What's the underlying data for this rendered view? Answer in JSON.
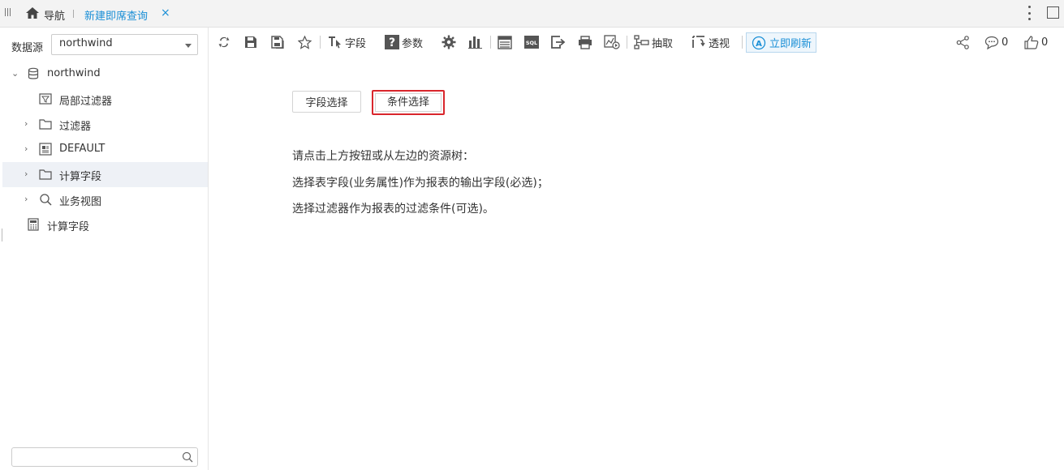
{
  "topbar": {
    "nav_label": "导航",
    "active_tab": "新建即席查询",
    "close_glyph": "×"
  },
  "sidebar": {
    "datasource_label": "数据源",
    "datasource_value": "northwind",
    "tree": [
      {
        "label": "northwind",
        "icon": "database-icon",
        "expanded": true
      },
      {
        "label": "局部过滤器",
        "icon": "local-filter-icon"
      },
      {
        "label": "过滤器",
        "icon": "folder-icon",
        "collapsed": true
      },
      {
        "label": "DEFAULT",
        "icon": "schema-icon",
        "collapsed": true
      },
      {
        "label": "计算字段",
        "icon": "folder-icon",
        "collapsed": true,
        "selected": true
      },
      {
        "label": "业务视图",
        "icon": "search-icon",
        "collapsed": true
      },
      {
        "label": "计算字段",
        "icon": "calculator-icon"
      }
    ],
    "search_placeholder": ""
  },
  "toolbar": {
    "field_label": "字段",
    "param_label": "参数",
    "extract_label": "抽取",
    "pivot_label": "透视",
    "refresh_label": "立即刷新",
    "comment_count": "0",
    "like_count": "0"
  },
  "main": {
    "field_select_button": "字段选择",
    "condition_select_button": "条件选择",
    "hints": [
      "请点击上方按钮或从左边的资源树：",
      "选择表字段(业务属性)作为报表的输出字段(必选)；",
      "选择过滤器作为报表的过滤条件(可选)。"
    ]
  },
  "colors": {
    "accent": "#1a8fd6",
    "highlight_border": "#d9262c",
    "selected_row": "#eef1f6"
  }
}
